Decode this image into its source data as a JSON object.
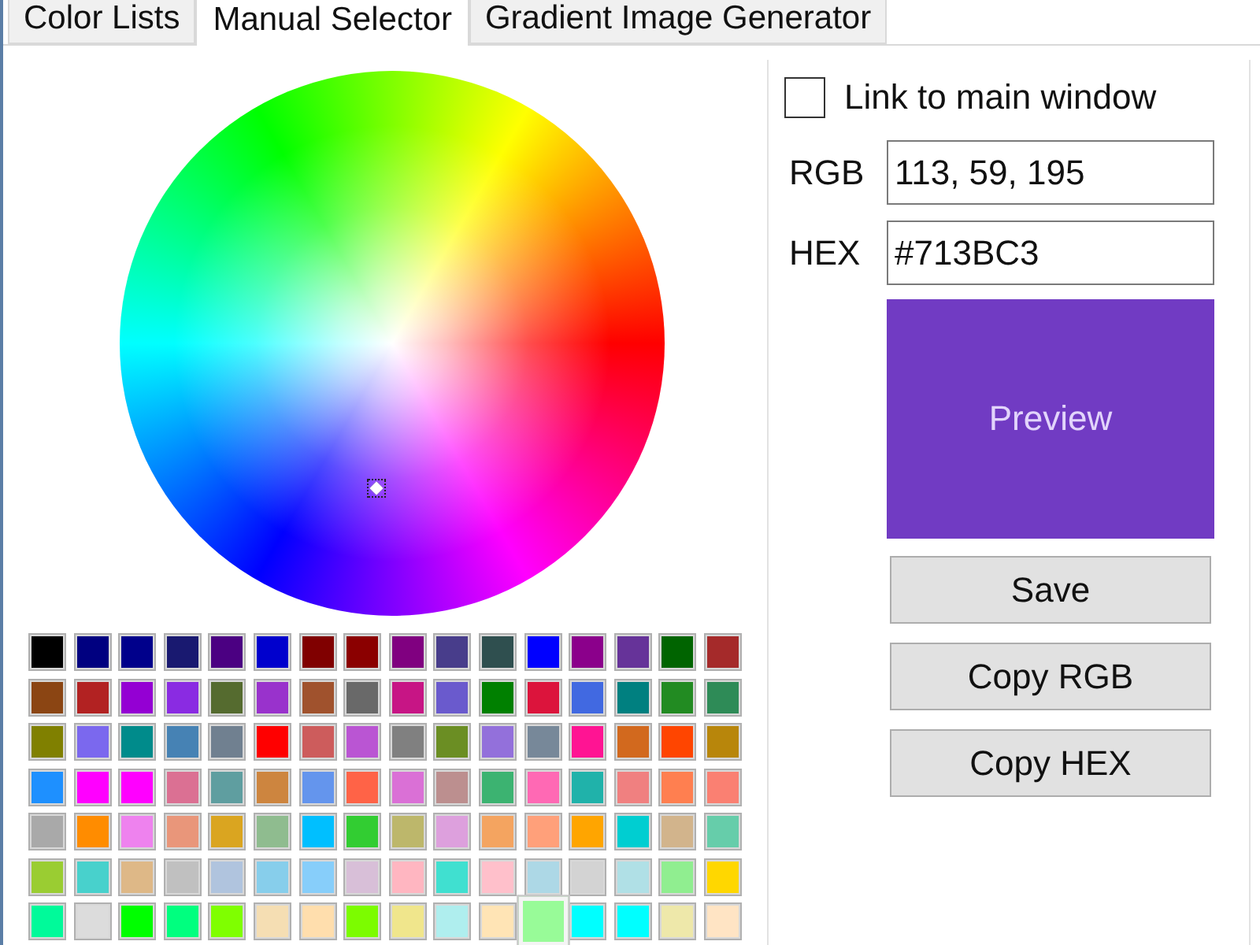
{
  "tabs": [
    {
      "label": "Color Lists",
      "selected": false
    },
    {
      "label": "Manual Selector",
      "selected": true
    },
    {
      "label": "Gradient Image Generator",
      "selected": false
    }
  ],
  "swatches": [
    [
      {
        "color": "#000000",
        "selected": false
      },
      {
        "color": "#000080",
        "selected": false
      },
      {
        "color": "#00008b",
        "selected": false
      },
      {
        "color": "#191970",
        "selected": false
      },
      {
        "color": "#4b0082",
        "selected": false
      },
      {
        "color": "#0000cd",
        "selected": false
      },
      {
        "color": "#800000",
        "selected": false
      },
      {
        "color": "#8b0000",
        "selected": false
      },
      {
        "color": "#800080",
        "selected": false
      },
      {
        "color": "#483d8b",
        "selected": false
      },
      {
        "color": "#2f4f4f",
        "selected": false
      },
      {
        "color": "#0000ff",
        "selected": false
      },
      {
        "color": "#8b008b",
        "selected": false
      },
      {
        "color": "#663399",
        "selected": false
      },
      {
        "color": "#006400",
        "selected": false
      },
      {
        "color": "#a52a2a",
        "selected": false
      }
    ],
    [
      {
        "color": "#8b4513",
        "selected": false
      },
      {
        "color": "#b22222",
        "selected": false
      },
      {
        "color": "#9400d3",
        "selected": false
      },
      {
        "color": "#8a2be2",
        "selected": false
      },
      {
        "color": "#556b2f",
        "selected": false
      },
      {
        "color": "#9932cc",
        "selected": false
      },
      {
        "color": "#a0522d",
        "selected": false
      },
      {
        "color": "#696969",
        "selected": false
      },
      {
        "color": "#c71585",
        "selected": false
      },
      {
        "color": "#6a5acd",
        "selected": false
      },
      {
        "color": "#008000",
        "selected": false
      },
      {
        "color": "#dc143c",
        "selected": false
      },
      {
        "color": "#4169e1",
        "selected": false
      },
      {
        "color": "#008080",
        "selected": false
      },
      {
        "color": "#228b22",
        "selected": false
      },
      {
        "color": "#2e8b57",
        "selected": false
      }
    ],
    [
      {
        "color": "#808000",
        "selected": false
      },
      {
        "color": "#7b68ee",
        "selected": false
      },
      {
        "color": "#008b8b",
        "selected": false
      },
      {
        "color": "#4682b4",
        "selected": false
      },
      {
        "color": "#708090",
        "selected": false
      },
      {
        "color": "#ff0000",
        "selected": false
      },
      {
        "color": "#cd5c5c",
        "selected": false
      },
      {
        "color": "#ba55d3",
        "selected": false
      },
      {
        "color": "#808080",
        "selected": false
      },
      {
        "color": "#6b8e23",
        "selected": false
      },
      {
        "color": "#9370db",
        "selected": false
      },
      {
        "color": "#778899",
        "selected": false
      },
      {
        "color": "#ff1493",
        "selected": false
      },
      {
        "color": "#d2691e",
        "selected": false
      },
      {
        "color": "#ff4500",
        "selected": false
      },
      {
        "color": "#b8860b",
        "selected": false
      }
    ],
    [
      {
        "color": "#1e90ff",
        "selected": false
      },
      {
        "color": "#ff00ff",
        "selected": false
      },
      {
        "color": "#ff00ff",
        "selected": false
      },
      {
        "color": "#db7093",
        "selected": false
      },
      {
        "color": "#5f9ea0",
        "selected": false
      },
      {
        "color": "#cd853f",
        "selected": false
      },
      {
        "color": "#6495ed",
        "selected": false
      },
      {
        "color": "#ff6347",
        "selected": false
      },
      {
        "color": "#da70d6",
        "selected": false
      },
      {
        "color": "#bc8f8f",
        "selected": false
      },
      {
        "color": "#3cb371",
        "selected": false
      },
      {
        "color": "#ff69b4",
        "selected": false
      },
      {
        "color": "#20b2aa",
        "selected": false
      },
      {
        "color": "#f08080",
        "selected": false
      },
      {
        "color": "#ff7f50",
        "selected": false
      },
      {
        "color": "#fa8072",
        "selected": false
      }
    ],
    [
      {
        "color": "#a9a9a9",
        "selected": false
      },
      {
        "color": "#ff8c00",
        "selected": false
      },
      {
        "color": "#ee82ee",
        "selected": false
      },
      {
        "color": "#e9967a",
        "selected": false
      },
      {
        "color": "#daa520",
        "selected": false
      },
      {
        "color": "#8fbc8f",
        "selected": false
      },
      {
        "color": "#00bfff",
        "selected": false
      },
      {
        "color": "#32cd32",
        "selected": false
      },
      {
        "color": "#bdb76b",
        "selected": false
      },
      {
        "color": "#dda0dd",
        "selected": false
      },
      {
        "color": "#f4a460",
        "selected": false
      },
      {
        "color": "#ffa07a",
        "selected": false
      },
      {
        "color": "#ffa500",
        "selected": false
      },
      {
        "color": "#00ced1",
        "selected": false
      },
      {
        "color": "#d2b48c",
        "selected": false
      },
      {
        "color": "#66cdaa",
        "selected": false
      }
    ],
    [
      {
        "color": "#9acd32",
        "selected": false
      },
      {
        "color": "#48d1cc",
        "selected": false
      },
      {
        "color": "#deb887",
        "selected": false
      },
      {
        "color": "#c0c0c0",
        "selected": false
      },
      {
        "color": "#b0c4de",
        "selected": false
      },
      {
        "color": "#87ceeb",
        "selected": false
      },
      {
        "color": "#87cefa",
        "selected": false
      },
      {
        "color": "#d8bfd8",
        "selected": false
      },
      {
        "color": "#ffb6c1",
        "selected": false
      },
      {
        "color": "#40e0d0",
        "selected": false
      },
      {
        "color": "#ffc0cb",
        "selected": false
      },
      {
        "color": "#add8e6",
        "selected": false
      },
      {
        "color": "#d3d3d3",
        "selected": false
      },
      {
        "color": "#b0e0e6",
        "selected": false
      },
      {
        "color": "#90ee90",
        "selected": false
      },
      {
        "color": "#ffd700",
        "selected": false
      }
    ],
    [
      {
        "color": "#00fa9a",
        "selected": false
      },
      {
        "color": "#dcdcdc",
        "selected": false
      },
      {
        "color": "#00ff00",
        "selected": false
      },
      {
        "color": "#00ff7f",
        "selected": false
      },
      {
        "color": "#7fff00",
        "selected": false
      },
      {
        "color": "#f5deb3",
        "selected": false
      },
      {
        "color": "#ffdead",
        "selected": false
      },
      {
        "color": "#7cfc00",
        "selected": false
      },
      {
        "color": "#f0e68c",
        "selected": false
      },
      {
        "color": "#afeeee",
        "selected": false
      },
      {
        "color": "#ffe4b5",
        "selected": false
      },
      {
        "color": "#98fb98",
        "selected": true
      },
      {
        "color": "#00ffff",
        "selected": false
      },
      {
        "color": "#00ffff",
        "selected": false
      },
      {
        "color": "#eee8aa",
        "selected": false
      },
      {
        "color": "#ffe4c4",
        "selected": false
      }
    ]
  ],
  "link_checkbox": {
    "label": "Link to main window",
    "checked": false
  },
  "fields": [
    {
      "label": "RGB",
      "value": "113, 59, 195"
    },
    {
      "label": "HEX",
      "value": "#713BC3"
    }
  ],
  "preview": {
    "label": "Preview",
    "color": "#713bc3"
  },
  "buttons": [
    "Save",
    "Copy RGB",
    "Copy HEX"
  ]
}
